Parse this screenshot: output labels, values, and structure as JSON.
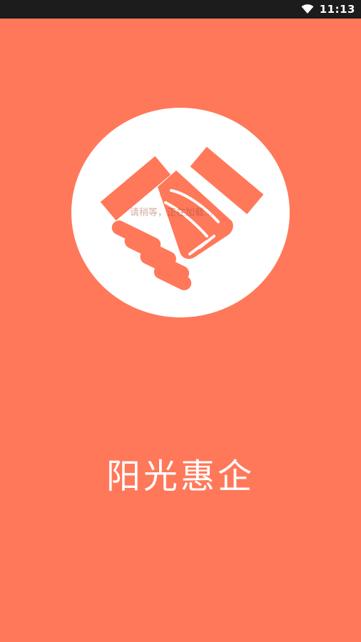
{
  "status_bar": {
    "time": "11:13",
    "wifi_icon": "wifi-icon"
  },
  "splash": {
    "logo_icon": "handshake-icon",
    "loading_text": "请稍等，正在加载...",
    "app_name": "阳光惠企"
  },
  "colors": {
    "background": "#ff785a",
    "logo_circle": "#ffffff",
    "status_bar": "#1c1c1c"
  }
}
